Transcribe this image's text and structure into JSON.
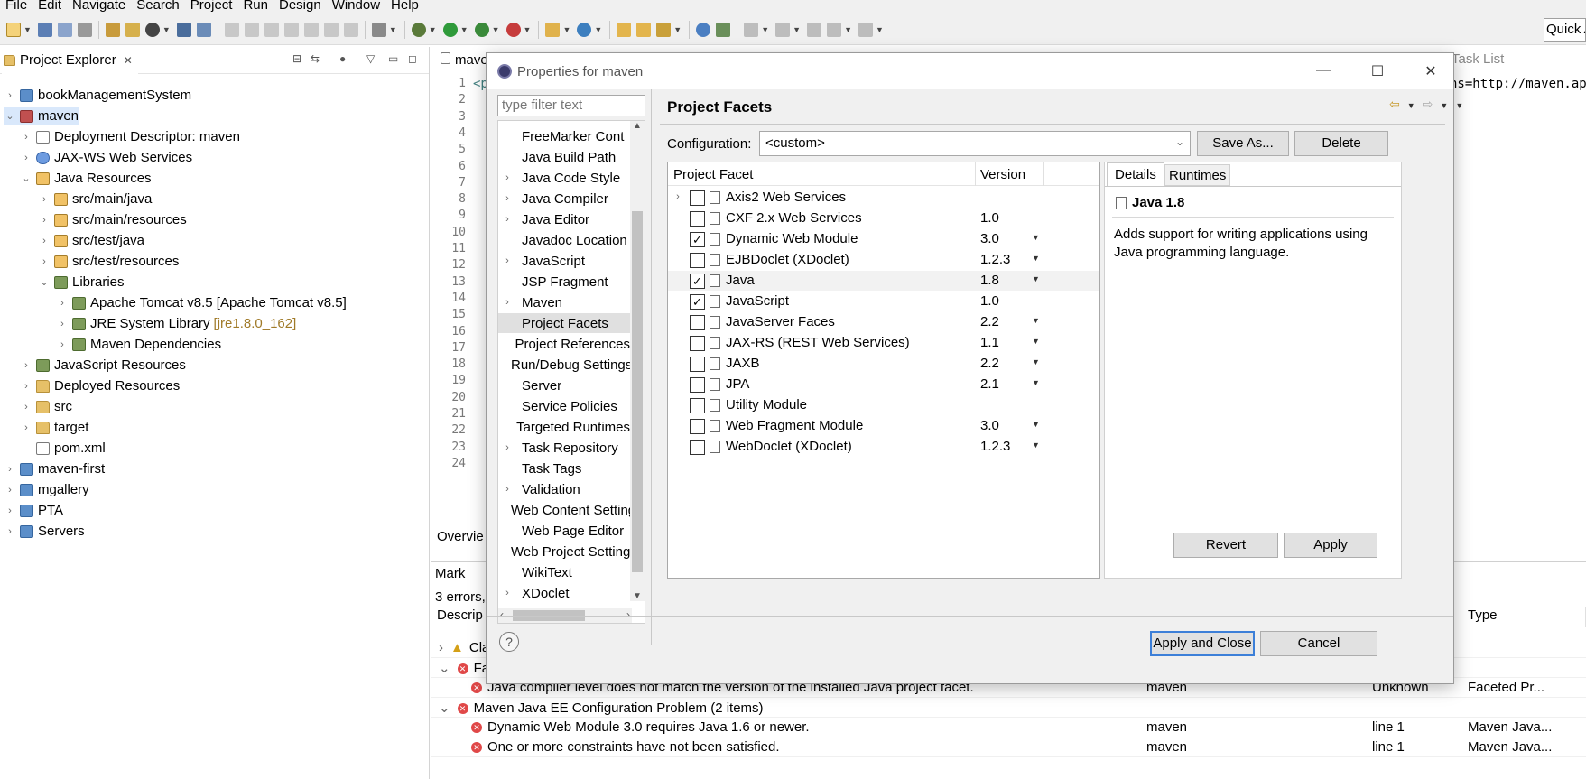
{
  "menubar": [
    {
      "label": "File"
    },
    {
      "label": "Edit"
    },
    {
      "label": "Navigate"
    },
    {
      "label": "Search"
    },
    {
      "label": "Project"
    },
    {
      "label": "Run"
    },
    {
      "label": "Design"
    },
    {
      "label": "Window"
    },
    {
      "label": "Help"
    }
  ],
  "toolbar": {
    "quick_access": "Quick Access"
  },
  "explorer": {
    "title": "Project Explorer",
    "items": [
      {
        "label": "bookManagementSystem"
      },
      {
        "label": "maven"
      },
      {
        "label": "Deployment Descriptor: maven"
      },
      {
        "label": "JAX-WS Web Services"
      },
      {
        "label": "Java Resources"
      },
      {
        "label": "src/main/java"
      },
      {
        "label": "src/main/resources"
      },
      {
        "label": "src/test/java"
      },
      {
        "label": "src/test/resources"
      },
      {
        "label": "Libraries"
      },
      {
        "label": "Apache Tomcat v8.5 [Apache Tomcat v8.5]"
      },
      {
        "label": "JRE System Library",
        "decoration": "[jre1.8.0_162]"
      },
      {
        "label": "Maven Dependencies"
      },
      {
        "label": "JavaScript Resources"
      },
      {
        "label": "Deployed Resources"
      },
      {
        "label": "src"
      },
      {
        "label": "target"
      },
      {
        "label": "pom.xml"
      },
      {
        "label": "maven-first"
      },
      {
        "label": "mgallery"
      },
      {
        "label": "PTA"
      },
      {
        "label": "Servers"
      }
    ]
  },
  "editor": {
    "tab": "maven",
    "first_line": "<p",
    "ns_text": "ns=http://maven.ap",
    "line_numbers": [
      "1",
      "2",
      "3",
      "4",
      "5",
      "6",
      "7",
      "8",
      "9",
      "10",
      "11",
      "12",
      "13",
      "14",
      "15",
      "16",
      "17",
      "18",
      "19",
      "20",
      "21",
      "22",
      "23",
      "24"
    ],
    "overview_tab": "Overvie",
    "tasklist_tab": "Task List"
  },
  "markers": {
    "tab": "Mark",
    "summary": "3 errors,",
    "columns": {
      "description": "Descrip",
      "type": "Type"
    },
    "rows": [
      {
        "label": "Cla",
        "resource": "",
        "location": "",
        "type": ""
      },
      {
        "label": "Fa",
        "resource": "",
        "location": "",
        "type": ""
      },
      {
        "label": "Java compiler level does not match the version of the installed Java project facet.",
        "resource": "maven",
        "location": "Unknown",
        "type": "Faceted Pr..."
      },
      {
        "label": "Maven Java EE Configuration Problem (2 items)",
        "resource": "",
        "location": "",
        "type": ""
      },
      {
        "label": "Dynamic Web Module 3.0 requires Java 1.6 or newer.",
        "resource": "maven",
        "location": "line 1",
        "type": "Maven Java..."
      },
      {
        "label": "One or more constraints have not been satisfied.",
        "resource": "maven",
        "location": "line 1",
        "type": "Maven Java..."
      }
    ]
  },
  "dialog": {
    "title": "Properties for maven",
    "filter_placeholder": "type filter text",
    "nav_items": [
      {
        "label": "FreeMarker Cont",
        "expandable": false
      },
      {
        "label": "Java Build Path",
        "expandable": false
      },
      {
        "label": "Java Code Style",
        "expandable": true
      },
      {
        "label": "Java Compiler",
        "expandable": true
      },
      {
        "label": "Java Editor",
        "expandable": true
      },
      {
        "label": "Javadoc Location",
        "expandable": false
      },
      {
        "label": "JavaScript",
        "expandable": true
      },
      {
        "label": "JSP Fragment",
        "expandable": false
      },
      {
        "label": "Maven",
        "expandable": true
      },
      {
        "label": "Project Facets",
        "expandable": false,
        "selected": true
      },
      {
        "label": "Project References",
        "expandable": false
      },
      {
        "label": "Run/Debug Settings",
        "expandable": false
      },
      {
        "label": "Server",
        "expandable": false
      },
      {
        "label": "Service Policies",
        "expandable": false
      },
      {
        "label": "Targeted Runtimes",
        "expandable": false
      },
      {
        "label": "Task Repository",
        "expandable": true
      },
      {
        "label": "Task Tags",
        "expandable": false
      },
      {
        "label": "Validation",
        "expandable": true
      },
      {
        "label": "Web Content Settings",
        "expandable": false
      },
      {
        "label": "Web Page Editor",
        "expandable": false
      },
      {
        "label": "Web Project Settings",
        "expandable": false
      },
      {
        "label": "WikiText",
        "expandable": false
      },
      {
        "label": "XDoclet",
        "expandable": true
      }
    ],
    "page_title": "Project Facets",
    "configuration": {
      "label": "Configuration:",
      "value": "<custom>"
    },
    "buttons": {
      "save_as": "Save As...",
      "delete": "Delete",
      "revert": "Revert",
      "apply": "Apply",
      "apply_close": "Apply and Close",
      "cancel": "Cancel",
      "help": "?"
    },
    "facets_columns": {
      "facet": "Project Facet",
      "version": "Version"
    },
    "facets": [
      {
        "name": "Axis2 Web Services",
        "version": "",
        "checked": false,
        "has_dropdown": false,
        "expandable": true
      },
      {
        "name": "CXF 2.x Web Services",
        "version": "1.0",
        "checked": false,
        "has_dropdown": false
      },
      {
        "name": "Dynamic Web Module",
        "version": "3.0",
        "checked": true,
        "has_dropdown": true
      },
      {
        "name": "EJBDoclet (XDoclet)",
        "version": "1.2.3",
        "checked": false,
        "has_dropdown": true
      },
      {
        "name": "Java",
        "version": "1.8",
        "checked": true,
        "has_dropdown": true,
        "selected": true
      },
      {
        "name": "JavaScript",
        "version": "1.0",
        "checked": true,
        "has_dropdown": false
      },
      {
        "name": "JavaServer Faces",
        "version": "2.2",
        "checked": false,
        "has_dropdown": true
      },
      {
        "name": "JAX-RS (REST Web Services)",
        "version": "1.1",
        "checked": false,
        "has_dropdown": true
      },
      {
        "name": "JAXB",
        "version": "2.2",
        "checked": false,
        "has_dropdown": true
      },
      {
        "name": "JPA",
        "version": "2.1",
        "checked": false,
        "has_dropdown": true
      },
      {
        "name": "Utility Module",
        "version": "",
        "checked": false,
        "has_dropdown": false
      },
      {
        "name": "Web Fragment Module",
        "version": "3.0",
        "checked": false,
        "has_dropdown": true
      },
      {
        "name": "WebDoclet (XDoclet)",
        "version": "1.2.3",
        "checked": false,
        "has_dropdown": true
      }
    ],
    "details": {
      "tab_details": "Details",
      "tab_runtimes": "Runtimes",
      "title": "Java 1.8",
      "description": "Adds support for writing applications using Java programming language."
    }
  }
}
